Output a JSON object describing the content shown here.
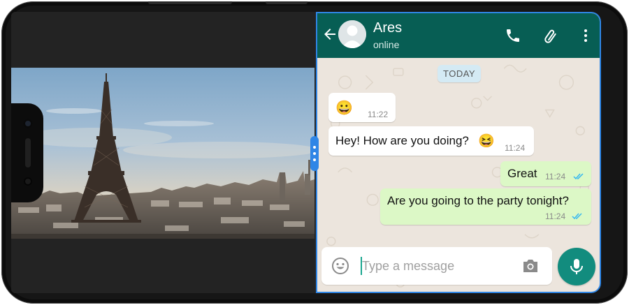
{
  "chat": {
    "contact_name": "Ares",
    "contact_status": "online",
    "date_chip": "TODAY",
    "messages": [
      {
        "direction": "in",
        "text": "😀",
        "time": "11:22"
      },
      {
        "direction": "in",
        "text": "Hey! How are you doing?",
        "emoji": "😆",
        "time": "11:24"
      },
      {
        "direction": "out",
        "text": "Great",
        "time": "11:24",
        "status": "read"
      },
      {
        "direction": "out",
        "text": "Are you going to the party tonight?",
        "time": "11:24",
        "status": "read"
      }
    ],
    "composer": {
      "placeholder": "Type a message"
    }
  },
  "colors": {
    "header": "#075e54",
    "incoming_bubble": "#ffffff",
    "outgoing_bubble": "#dcf8c6",
    "chat_background": "#ece5dd",
    "mic_button": "#128c7e",
    "split_divider": "#2f86e6",
    "read_ticks": "#34b7f1"
  },
  "icons": {
    "back": "arrow-left-icon",
    "call": "phone-icon",
    "attach": "paperclip-icon",
    "menu": "kebab-menu-icon",
    "emoji": "smiley-icon",
    "camera": "camera-icon",
    "mic": "microphone-icon"
  }
}
